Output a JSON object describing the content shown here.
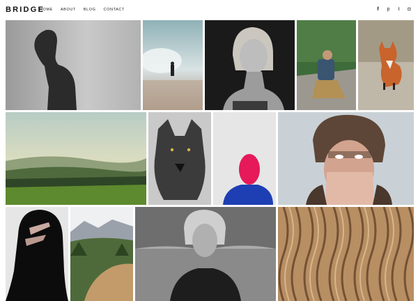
{
  "brand": {
    "logo": "BRIDGE"
  },
  "nav": {
    "items": [
      "HOME",
      "ABOUT",
      "BLOG",
      "CONTACT"
    ]
  },
  "social": {
    "icons": [
      "facebook-icon",
      "pinterest-icon",
      "twitter-icon",
      "instagram-icon"
    ],
    "glyphs": [
      "f",
      "p",
      "t",
      "◘"
    ]
  },
  "gallery": {
    "tiles": [
      "man-profile-photo",
      "surfer-waves-photo",
      "woman-portrait-photo",
      "man-drinking-road-photo",
      "fox-photo",
      "green-hills-landscape-photo",
      "wolf-photo",
      "pink-mask-photo",
      "woman-fur-hat-photo",
      "hooded-face-photo",
      "mountain-valley-photo",
      "woman-water-photo",
      "wavy-wood-texture-photo"
    ]
  },
  "colors": {
    "background": "#ffffff",
    "text": "#111111"
  }
}
